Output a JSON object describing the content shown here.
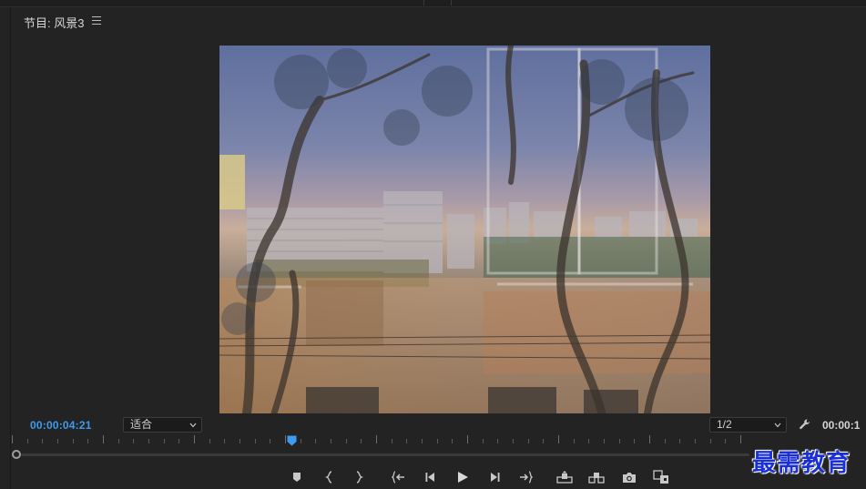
{
  "panel": {
    "title": "节目: 风景3",
    "menu_icon": "hamburger-menu-icon"
  },
  "viewer": {
    "content": "blended-landscape-video-frame"
  },
  "controls": {
    "current_timecode": "00:00:04:21",
    "fit_dropdown": "适合",
    "resolution_dropdown": "1/2",
    "duration_timecode": "00:00:1",
    "wrench_icon": "wrench-settings-icon"
  },
  "timeline": {
    "playhead_fraction": 0.33
  },
  "transport": {
    "buttons": [
      {
        "name": "add-marker-button",
        "icon": "marker-icon"
      },
      {
        "name": "mark-in-button",
        "icon": "mark-in-icon"
      },
      {
        "name": "mark-out-button",
        "icon": "mark-out-icon"
      },
      {
        "name": "go-to-in-button",
        "icon": "go-to-in-icon"
      },
      {
        "name": "step-back-button",
        "icon": "step-back-icon"
      },
      {
        "name": "play-button",
        "icon": "play-icon"
      },
      {
        "name": "step-forward-button",
        "icon": "step-forward-icon"
      },
      {
        "name": "go-to-out-button",
        "icon": "go-to-out-icon"
      },
      {
        "name": "lift-button",
        "icon": "lift-icon"
      },
      {
        "name": "extract-button",
        "icon": "extract-icon"
      },
      {
        "name": "export-frame-button",
        "icon": "camera-icon"
      },
      {
        "name": "compare-view-button",
        "icon": "comparison-icon"
      }
    ]
  },
  "colors": {
    "accent_timecode": "#3d9bf0",
    "background": "#232323",
    "watermark": "#1a2fd6"
  },
  "watermark": {
    "text": "最需教育"
  }
}
